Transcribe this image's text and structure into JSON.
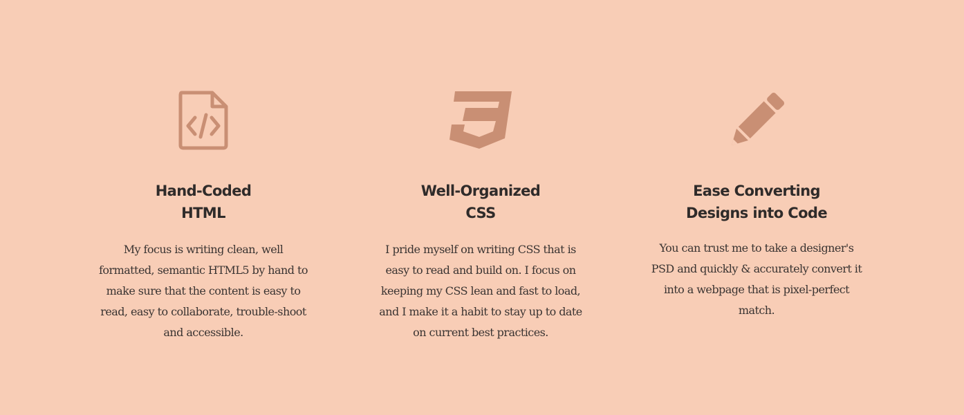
{
  "theme": {
    "background": "#f8cdb6",
    "icon_color": "#c98f74",
    "heading_color": "#2f2b2a",
    "text_color": "#3a3432"
  },
  "features": [
    {
      "icon": "html-file-code-icon",
      "title_line1": "Hand-Coded",
      "title_line2": "HTML",
      "text": "My focus is writing clean, well formatted, semantic HTML5 by hand to make sure that the content is easy to read, easy to collaborate, trouble-shoot and accessible."
    },
    {
      "icon": "css3-shield-icon",
      "title_line1": "Well-Organized",
      "title_line2": "CSS",
      "text": "I pride myself on writing CSS that is easy to read and build on. I focus on keeping my CSS lean and fast to load, and I make it a habit to stay up to date on current best practices."
    },
    {
      "icon": "pencil-icon",
      "title_line1": "Ease Converting",
      "title_line2": "Designs into Code",
      "text": "You can trust me to take a designer's PSD and quickly & accurately convert it into a webpage that is pixel-perfect match."
    }
  ]
}
